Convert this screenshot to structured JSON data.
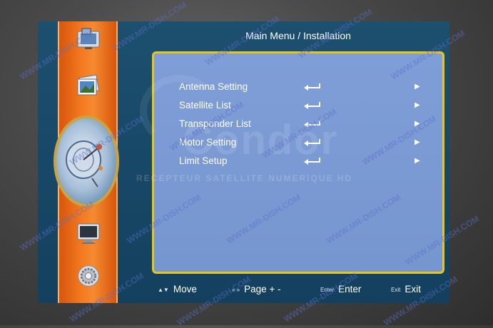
{
  "header": {
    "title": "Main Menu / Installation"
  },
  "menu": {
    "items": [
      {
        "label": "Antenna Setting"
      },
      {
        "label": "Satellite List"
      },
      {
        "label": "Transponder List"
      },
      {
        "label": "Motor Setting"
      },
      {
        "label": "Limit Setup"
      }
    ]
  },
  "brand": {
    "logo_text": "Condor",
    "tagline": "RECEPTEUR SATELLITE NUMERIQUE HD"
  },
  "footer": {
    "move": {
      "key": "▲▼",
      "label": "Move"
    },
    "page": {
      "key": "« »",
      "label": "Page + -"
    },
    "enter": {
      "key": "Enter",
      "label": "Enter"
    },
    "exit": {
      "key": "Exit",
      "label": "Exit"
    }
  },
  "sidebar": {
    "icons": [
      "tv-photo-icon",
      "photos-icon",
      "satellite-dish-icon",
      "tv-monitor-icon",
      "settings-gear-icon"
    ]
  },
  "watermark": {
    "text": "WWW.MR-DISH.COM"
  },
  "colors": {
    "screen_bg": "#184868",
    "panel_bg": "#7b9ad4",
    "panel_border": "#e8c51c",
    "sidebar": "#f47a20"
  }
}
